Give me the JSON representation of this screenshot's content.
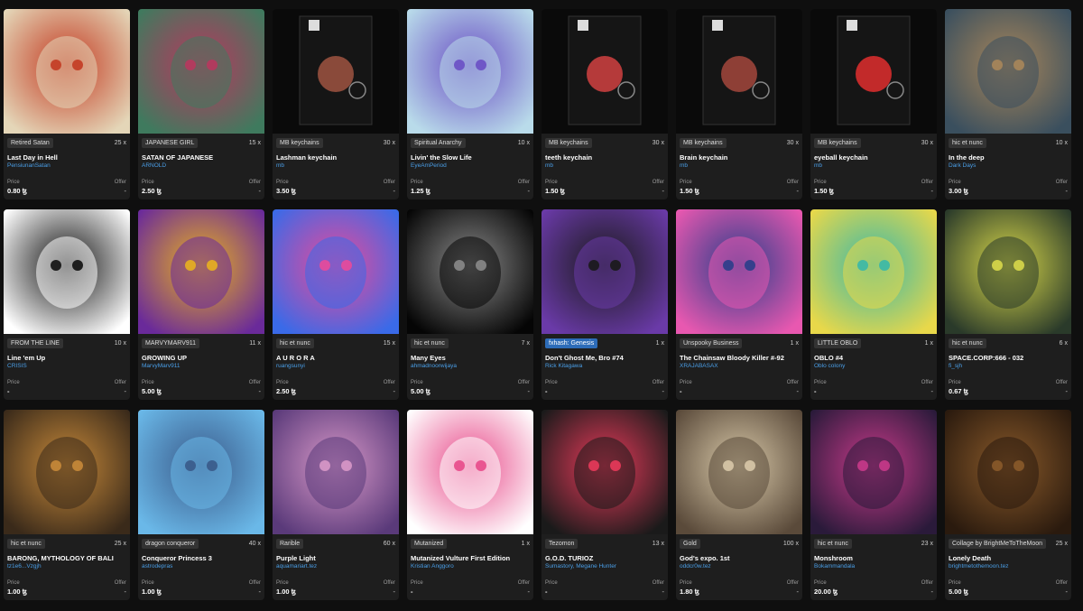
{
  "labels": {
    "price": "Price",
    "offer": "Offer"
  },
  "cards": [
    {
      "collection": "Retired Satan",
      "editions": "25 x",
      "title": "Last Day in Hell",
      "artist": "PensiunanSatan",
      "price": "0.80 ꜩ",
      "offer": "-",
      "icon": "devil-skull-art",
      "colors": [
        "#e4d6b8",
        "#c33b22"
      ]
    },
    {
      "collection": "JAPANESE GIRL",
      "editions": "15 x",
      "title": "SATAN OF JAPANESE",
      "artist": "ARNOLD",
      "price": "2.50 ꜩ",
      "offer": "-",
      "icon": "oni-mask-art",
      "colors": [
        "#3f7a5e",
        "#b8375e"
      ]
    },
    {
      "collection": "MB keychains",
      "editions": "30 x",
      "title": "Lashman keychain",
      "artist": "mb",
      "price": "3.50 ꜩ",
      "offer": "-",
      "icon": "keychain-art",
      "colors": [
        "#0a0a0a",
        "#8a4a3a"
      ]
    },
    {
      "collection": "Spiritual Anarchy",
      "editions": "10 x",
      "title": "Livin' the Slow Life",
      "artist": "EyeAmPeriod",
      "price": "1.25 ꜩ",
      "offer": "-",
      "icon": "cartoon-character-art",
      "colors": [
        "#b9dbea",
        "#6a4fc4"
      ]
    },
    {
      "collection": "MB keychains",
      "editions": "30 x",
      "title": "teeth keychain",
      "artist": "mb",
      "price": "1.50 ꜩ",
      "offer": "-",
      "icon": "keychain-art",
      "colors": [
        "#0a0a0a",
        "#b53a3a"
      ]
    },
    {
      "collection": "MB keychains",
      "editions": "30 x",
      "title": "Brain keychain",
      "artist": "mb",
      "price": "1.50 ꜩ",
      "offer": "-",
      "icon": "keychain-art",
      "colors": [
        "#0a0a0a",
        "#8e3f36"
      ]
    },
    {
      "collection": "MB keychains",
      "editions": "30 x",
      "title": "eyeball keychain",
      "artist": "mb",
      "price": "1.50 ꜩ",
      "offer": "-",
      "icon": "keychain-art",
      "colors": [
        "#0a0a0a",
        "#c22a2a"
      ]
    },
    {
      "collection": "hic et nunc",
      "editions": "10 x",
      "title": "In the deep",
      "artist": "Dark Days",
      "price": "3.00 ꜩ",
      "offer": "-",
      "icon": "diver-skull-art",
      "colors": [
        "#3a4f5e",
        "#a8865a"
      ]
    },
    {
      "collection": "FROM THE LINE",
      "editions": "10 x",
      "title": "Line 'em Up",
      "artist": "CRISIS",
      "price": "-",
      "offer": "-",
      "icon": "line-drawing-art",
      "colors": [
        "#ffffff",
        "#111111"
      ]
    },
    {
      "collection": "MARVYMARV911",
      "editions": "11 x",
      "title": "GROWING UP",
      "artist": "MarvyMarv911",
      "price": "5.00 ꜩ",
      "offer": "-",
      "icon": "psychedelic-art",
      "colors": [
        "#6a2a9a",
        "#e8b020"
      ]
    },
    {
      "collection": "hic et nunc",
      "editions": "15 x",
      "title": "A U R O R A",
      "artist": "ruangsunyi",
      "price": "2.50 ꜩ",
      "offer": "-",
      "icon": "colorful-abstract-art",
      "colors": [
        "#3a6ae8",
        "#e84a9a"
      ]
    },
    {
      "collection": "hic et nunc",
      "editions": "7 x",
      "title": "Many Eyes",
      "artist": "ahmadnoorwijaya",
      "price": "5.00 ꜩ",
      "offer": "-",
      "icon": "figure-3d-art",
      "colors": [
        "#050505",
        "#8a8a8a"
      ]
    },
    {
      "collection": "fxhash: Genesis",
      "editions": "1 x",
      "title": "Don't Ghost Me, Bro #74",
      "artist": "Rick Kitagawa",
      "price": "-",
      "offer": "-",
      "icon": "ghost-art",
      "colors": [
        "#6a3aa8",
        "#1a1a1a"
      ],
      "highlight": true
    },
    {
      "collection": "Unspooky Business",
      "editions": "1 x",
      "title": "The Chainsaw Bloody Killer #-92",
      "artist": "XRAJABASAX",
      "price": "-",
      "offer": "-",
      "icon": "killer-art",
      "colors": [
        "#e858b0",
        "#2a3e8a"
      ]
    },
    {
      "collection": "LITTLE OBLO",
      "editions": "1 x",
      "title": "OBLO #4",
      "artist": "Oblo colony",
      "price": "-",
      "offer": "-",
      "icon": "monster-art",
      "colors": [
        "#e8d84a",
        "#3ab8a8"
      ]
    },
    {
      "collection": "hic et nunc",
      "editions": "6 x",
      "title": "SPACE.CORP:666 - 032",
      "artist": "fi_sjh",
      "price": "0.67 ꜩ",
      "offer": "-",
      "icon": "poster-art",
      "colors": [
        "#2a3a2a",
        "#d8d84a"
      ]
    },
    {
      "collection": "hic et nunc",
      "editions": "25 x",
      "title": "BARONG, MYTHOLOGY OF BALI",
      "artist": "tz1e6...Vzgjh",
      "price": "1.00 ꜩ",
      "offer": "-",
      "icon": "barong-mask-art",
      "colors": [
        "#3a2a1a",
        "#c88a3a"
      ]
    },
    {
      "collection": "dragon conqueror",
      "editions": "40 x",
      "title": "Conqueror Princess 3",
      "artist": "astrodepras",
      "price": "1.00 ꜩ",
      "offer": "-",
      "icon": "anime-girl-art",
      "colors": [
        "#6ab8e8",
        "#3a5a8a"
      ]
    },
    {
      "collection": "Rarible",
      "editions": "60 x",
      "title": "Purple Light",
      "artist": "aquamariart.tez",
      "price": "1.00 ꜩ",
      "offer": "-",
      "icon": "portrait-art",
      "colors": [
        "#5a3a7a",
        "#d898c8"
      ]
    },
    {
      "collection": "Mutanized",
      "editions": "1 x",
      "title": "Mutanized Vulture First Edition",
      "artist": "Kristian Anggoro",
      "price": "-",
      "offer": "-",
      "icon": "vulture-art",
      "colors": [
        "#ffffff",
        "#e84a8a"
      ]
    },
    {
      "collection": "Tezomon",
      "editions": "13 x",
      "title": "G.O.D. TURIOZ",
      "artist": "Sumastory, Megane Hunter",
      "price": "-",
      "offer": "-",
      "icon": "trading-card-art",
      "colors": [
        "#1a1a1a",
        "#e83a5a"
      ]
    },
    {
      "collection": "Gold",
      "editions": "100 x",
      "title": "God's expo. 1st",
      "artist": "oddcr0w.tez",
      "price": "1.80 ꜩ",
      "offer": "-",
      "icon": "statue-art",
      "colors": [
        "#5a4a3a",
        "#d8c8a8"
      ]
    },
    {
      "collection": "hic et nunc",
      "editions": "23 x",
      "title": "Monshroom",
      "artist": "Bokammandala",
      "price": "20.00 ꜩ",
      "offer": "-",
      "icon": "mushroom-art",
      "colors": [
        "#2a1a3a",
        "#c83a8a"
      ]
    },
    {
      "collection": "Collage by BrightMeToTheMoon",
      "editions": "25 x",
      "title": "Lonely Death",
      "artist": "brightmetothemoon.tez",
      "price": "5.00 ꜩ",
      "offer": "-",
      "icon": "painting-art",
      "colors": [
        "#2a1a0e",
        "#8a5a2a"
      ]
    }
  ]
}
